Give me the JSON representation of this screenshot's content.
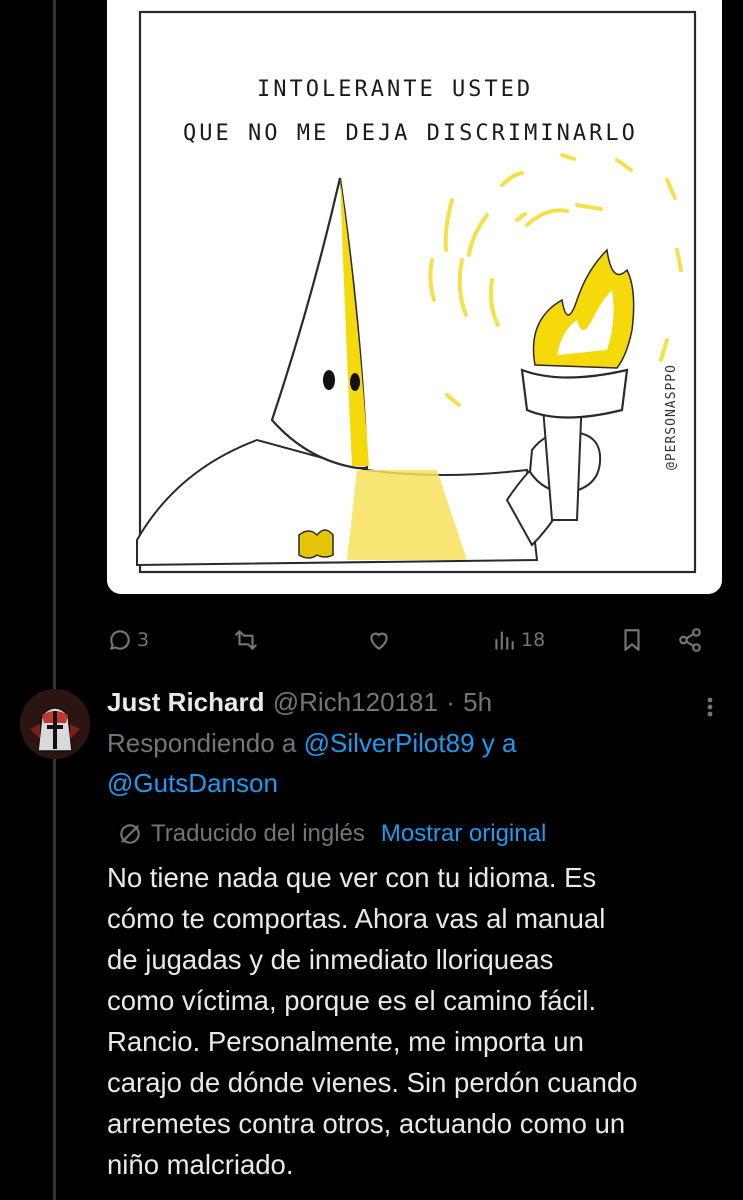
{
  "image": {
    "caption_line1": "INTOLERANTE USTED",
    "caption_line2": "QUE NO ME DEJA DISCRIMINARLO",
    "signature": "@PERSONASPPO"
  },
  "actions": {
    "replies": "3",
    "views": "18"
  },
  "reply": {
    "name": "Just Richard",
    "handle": "@Rich120181",
    "separator": "·",
    "time": "5h",
    "replying_prefix": "Respondiendo a",
    "mention1": "@SilverPilot89",
    "and": "y a",
    "mention2": "@GutsDanson",
    "translated_label": "Traducido del inglés",
    "show_original": "Mostrar original",
    "text": "No tiene nada que ver con tu idioma. Es\ncómo te comportas. Ahora vas al manual\nde jugadas y de inmediato lloriqueas\ncomo víctima, porque es el camino fácil.\nRancio. Personalmente, me importa un\ncarajo de dónde vienes. Sin perdón cuando\narremetes contra otros, actuando como un\nniño malcriado."
  },
  "colors": {
    "background": "#000000",
    "text": "#e7e9ea",
    "muted": "#71767b",
    "link": "#1d9bf0",
    "flame": "#f5d90a"
  }
}
